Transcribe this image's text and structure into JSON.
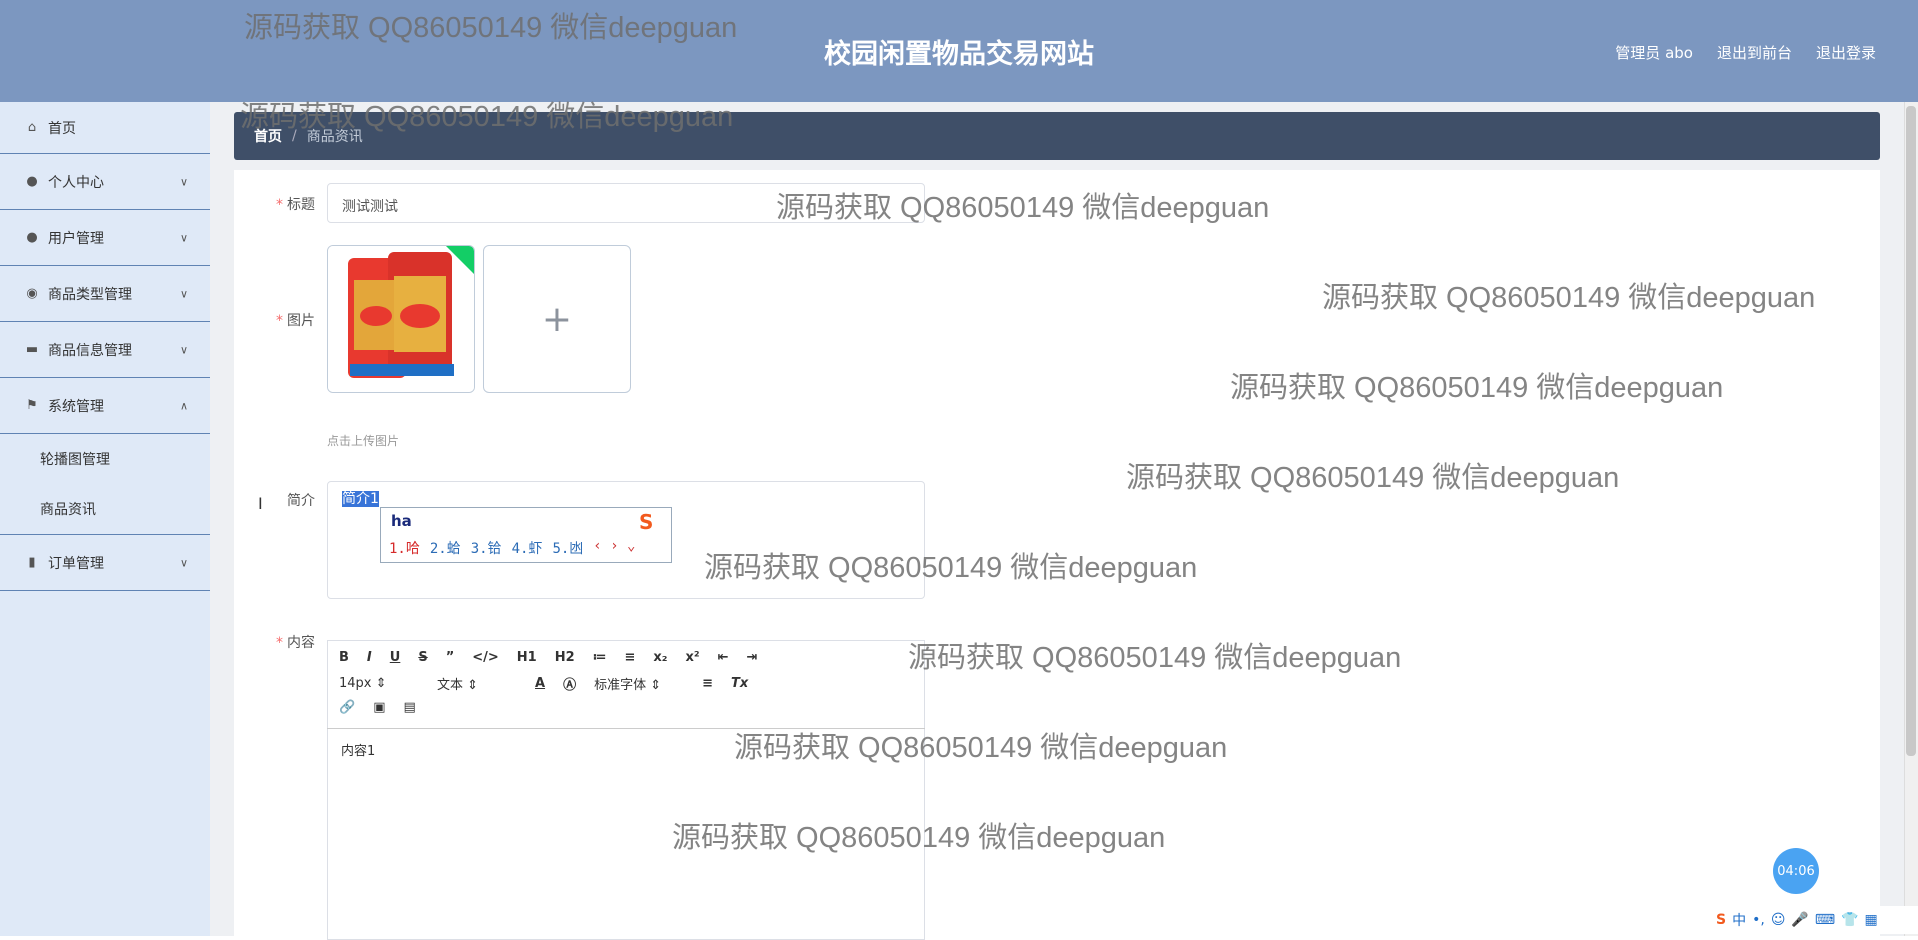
{
  "header": {
    "title": "校园闲置物品交易网站",
    "admin_label": "管理员 abo",
    "to_front_label": "退出到前台",
    "logout_label": "退出登录"
  },
  "sidebar": {
    "items": [
      {
        "label": "首页",
        "icon": "home-icon"
      },
      {
        "label": "个人中心",
        "icon": "user-icon"
      },
      {
        "label": "用户管理",
        "icon": "user-icon"
      },
      {
        "label": "商品类型管理",
        "icon": "location-icon"
      },
      {
        "label": "商品信息管理",
        "icon": "ticket-icon"
      },
      {
        "label": "系统管理",
        "icon": "flag-icon"
      },
      {
        "label": "订单管理",
        "icon": "bar-chart-icon"
      }
    ],
    "submenu": [
      "轮播图管理",
      "商品资讯"
    ]
  },
  "breadcrumb": {
    "home": "首页",
    "sep": "/",
    "current": "商品资讯"
  },
  "form": {
    "title_label": "标题",
    "title_value": "测试测试",
    "image_label": "图片",
    "upload_tip": "点击上传图片",
    "intro_label": "简介",
    "intro_value": "简介1",
    "content_label": "内容",
    "content_value": "内容1"
  },
  "ime": {
    "input": "ha",
    "candidates": [
      "1.哈",
      "2.蛤",
      "3.铪",
      "4.虾",
      "5.凼"
    ]
  },
  "editor": {
    "row1": [
      "B",
      "I",
      "U",
      "S",
      "”",
      "</>",
      "H1",
      "H2",
      "≔",
      "≡",
      "x₂",
      "x²",
      "⇤",
      "⇥"
    ],
    "size": "14px",
    "style": "文本",
    "font": "标准字体"
  },
  "watermark": "源码获取 QQ86050149 微信deepguan",
  "timer": "04:06",
  "tray": [
    "S",
    "中",
    "•,",
    "☺",
    "🎤",
    "⌨",
    "👕",
    "▦"
  ]
}
